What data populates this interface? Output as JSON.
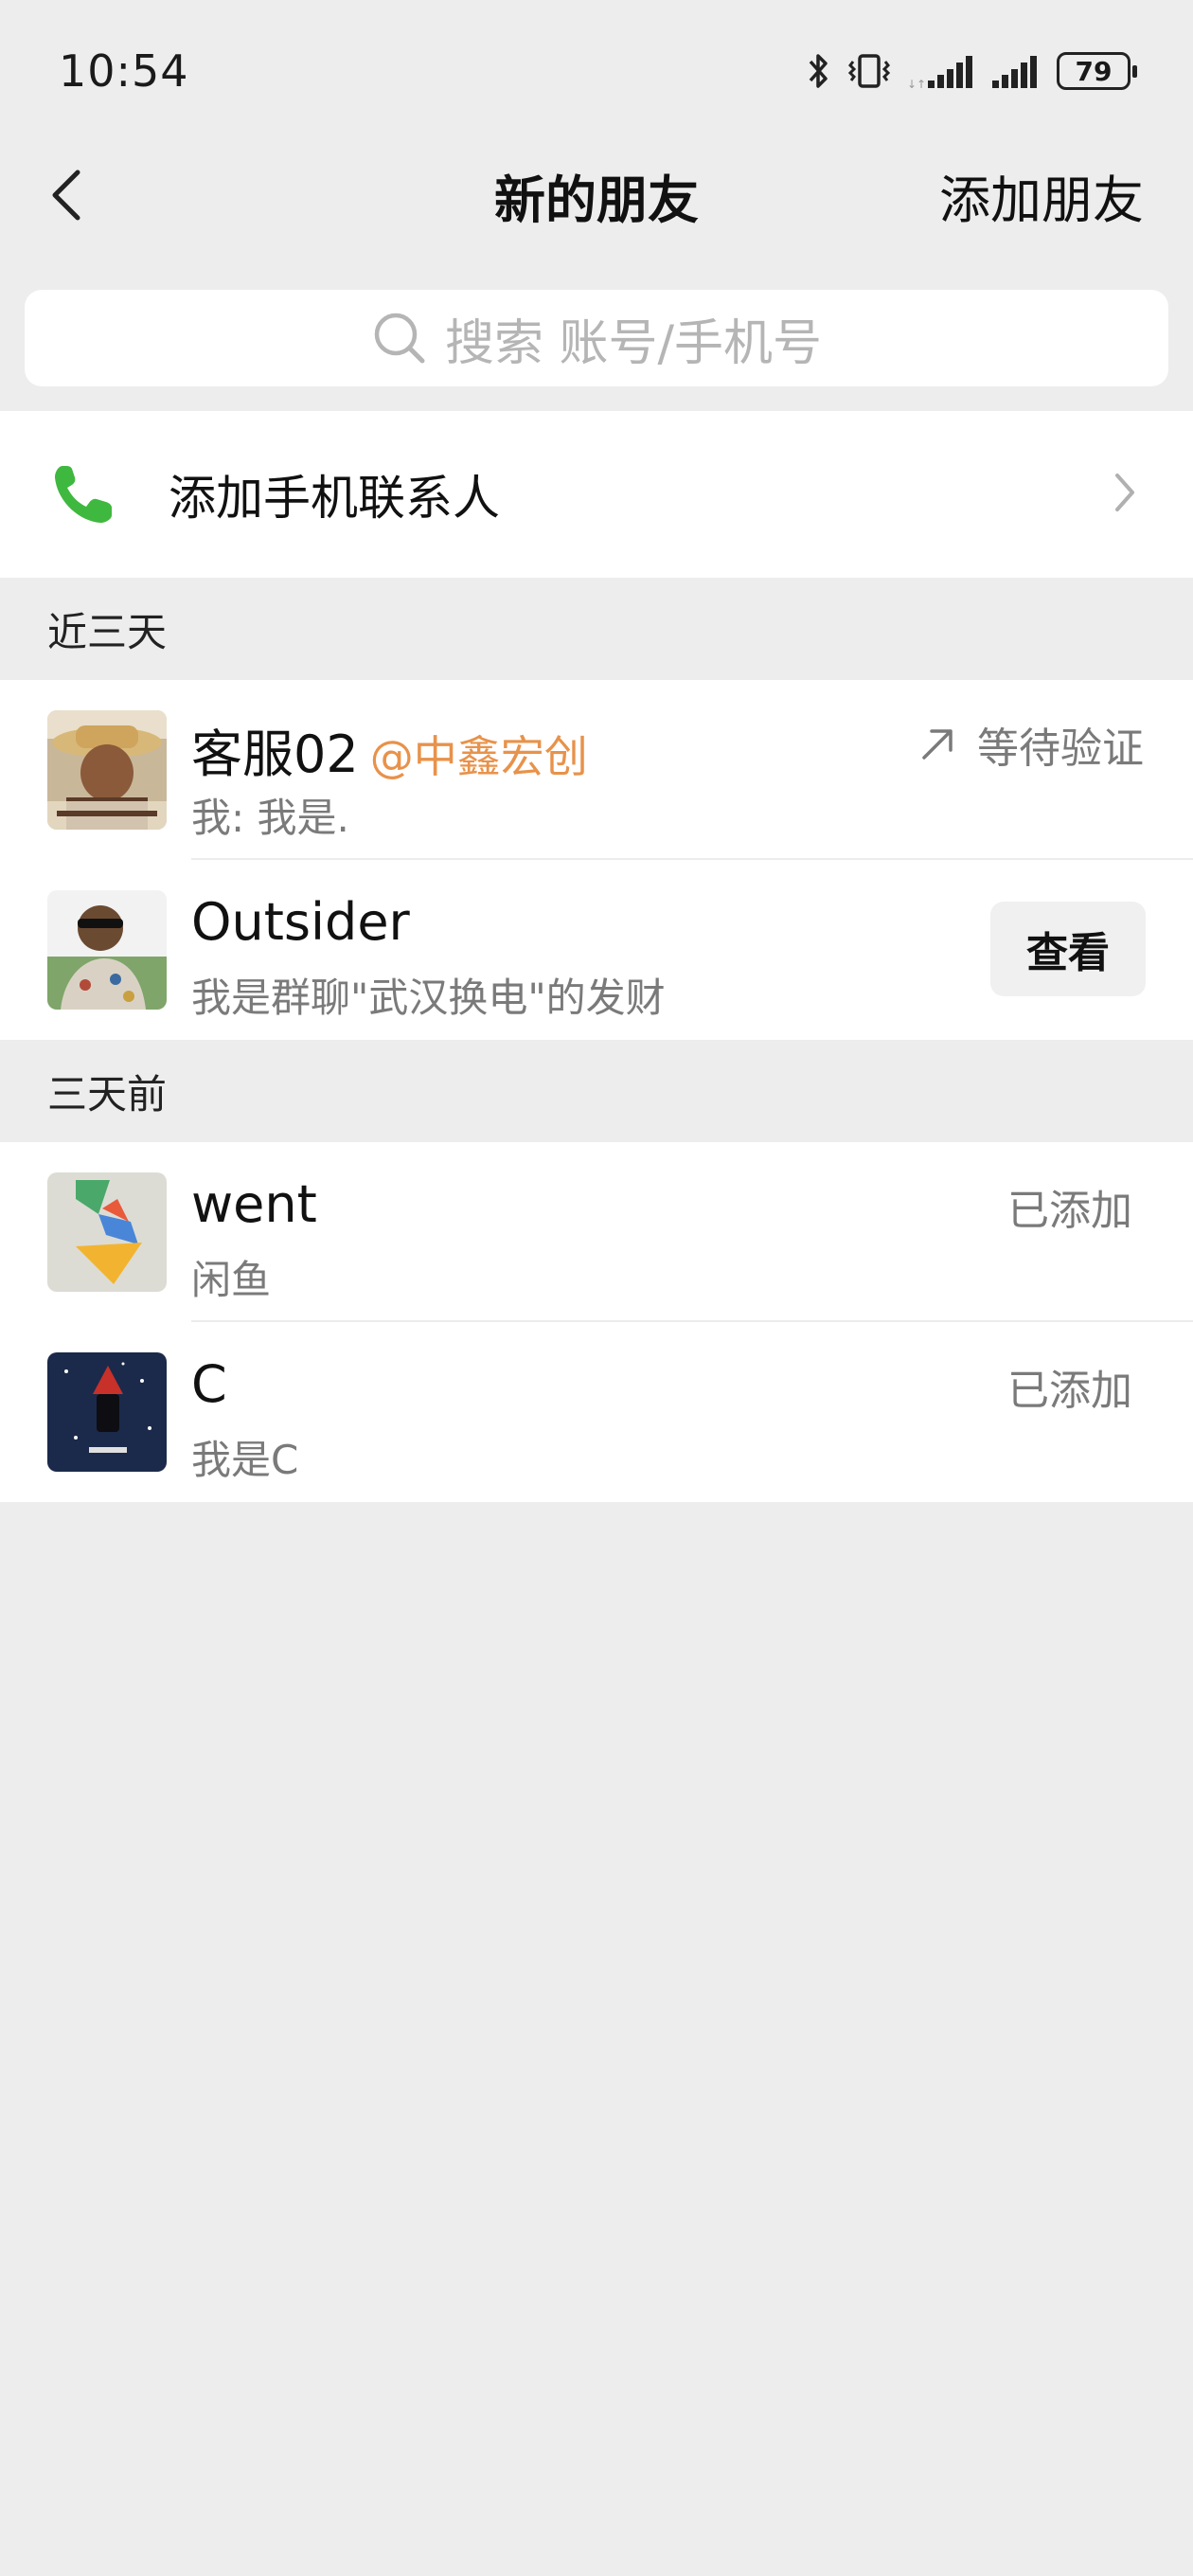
{
  "status_bar": {
    "time": "10:54",
    "battery": "79",
    "icons": [
      "bluetooth-icon",
      "vibrate-icon",
      "signal-icon",
      "signal-icon"
    ]
  },
  "nav": {
    "title": "新的朋友",
    "action": "添加朋友"
  },
  "search": {
    "placeholder": "搜索 账号/手机号"
  },
  "add_contacts": {
    "label": "添加手机联系人",
    "icon": "phone-icon",
    "icon_color": "#3fb83f"
  },
  "sections": [
    {
      "title": "近三天",
      "items": [
        {
          "name": "客服02",
          "org": "@中鑫宏创",
          "message": "我: 我是.",
          "status": "等待验证"
        },
        {
          "name": "Outsider",
          "message": "我是群聊\"武汉换电\"的发财",
          "button": "查看"
        }
      ]
    },
    {
      "title": "三天前",
      "items": [
        {
          "name": "went",
          "message": "闲鱼",
          "status": "已添加"
        },
        {
          "name": "C",
          "message": "我是C",
          "status": "已添加"
        }
      ]
    }
  ],
  "colors": {
    "background": "#ededed",
    "org_accent": "#e8924a",
    "secondary_text": "#7a7a7a"
  }
}
